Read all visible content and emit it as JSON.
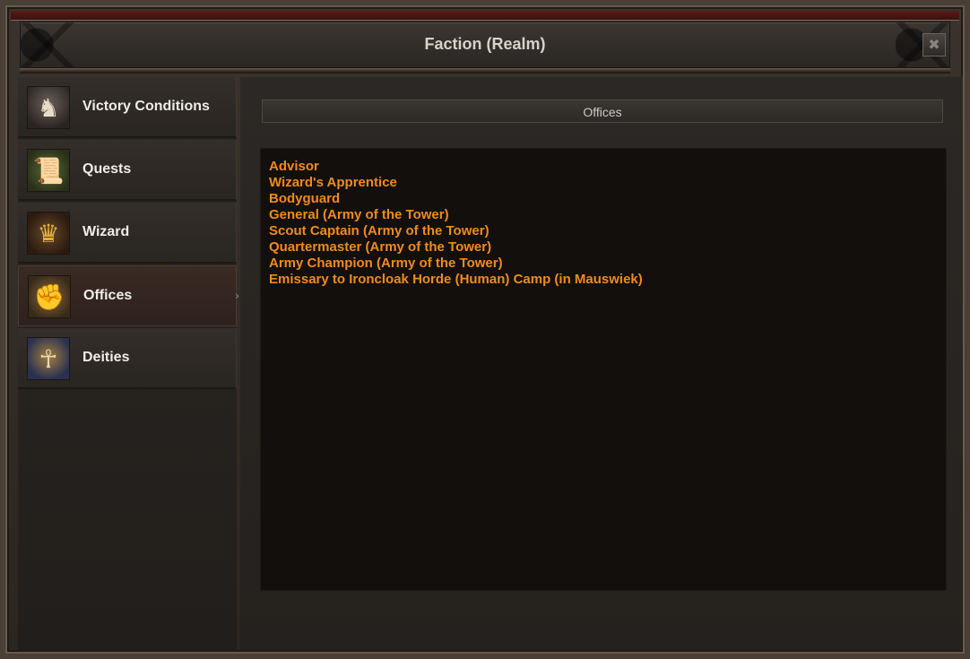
{
  "window": {
    "title": "Faction (Realm)",
    "close_icon": "✖"
  },
  "sidebar": {
    "items": [
      {
        "label": "Victory Conditions",
        "icon": "chess-knight-icon",
        "glyph": "♞"
      },
      {
        "label": "Quests",
        "icon": "scroll-icon",
        "glyph": "📜"
      },
      {
        "label": "Wizard",
        "icon": "crown-icon",
        "glyph": "♛"
      },
      {
        "label": "Offices",
        "icon": "gauntlet-icon",
        "glyph": "✊"
      },
      {
        "label": "Deities",
        "icon": "deity-portrait-icon",
        "glyph": "☥"
      }
    ],
    "active_index": 3
  },
  "main": {
    "section_title": "Offices",
    "offices": [
      "Advisor",
      "Wizard's Apprentice",
      "Bodyguard",
      "General (Army of the Tower)",
      "Scout Captain (Army of the Tower)",
      "Quartermaster (Army of the Tower)",
      "Army Champion (Army of the Tower)",
      "Emissary to Ironcloak Horde (Human) Camp (in Mauswiek)"
    ]
  },
  "colors": {
    "accent_orange": "#f28a1c",
    "title_text": "#d8d2c8",
    "trim_red": "#5a1a16"
  }
}
